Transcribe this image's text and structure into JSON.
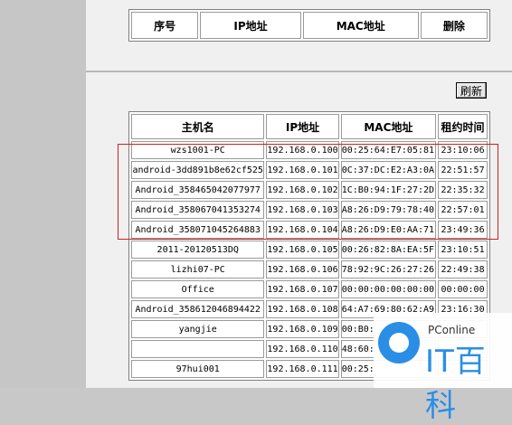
{
  "top_table": {
    "headers": [
      "序号",
      "IP地址",
      "MAC地址",
      "删除"
    ]
  },
  "refresh_label": "刷新",
  "dhcp_table": {
    "headers": [
      "主机名",
      "IP地址",
      "MAC地址",
      "租约时间"
    ],
    "rows": [
      [
        "wzs1001-PC",
        "192.168.0.100",
        "00:25:64:E7:05:81",
        "23:10:06"
      ],
      [
        "android-3dd891b8e62cf525",
        "192.168.0.101",
        "0C:37:DC:E2:A3:0A",
        "22:51:57"
      ],
      [
        "Android_358465042077977",
        "192.168.0.102",
        "1C:B0:94:1F:27:2D",
        "22:35:32"
      ],
      [
        "Android_358067041353274",
        "192.168.0.103",
        "A8:26:D9:79:78:40",
        "22:57:01"
      ],
      [
        "Android_358071045264883",
        "192.168.0.104",
        "A8:26:D9:E0:AA:71",
        "23:49:36"
      ],
      [
        "2011-20120513DQ",
        "192.168.0.105",
        "00:26:82:8A:EA:5F",
        "23:10:51"
      ],
      [
        "lizhi07-PC",
        "192.168.0.106",
        "78:92:9C:26:27:26",
        "22:49:38"
      ],
      [
        "Office",
        "192.168.0.107",
        "00:00:00:00:00:00",
        "00:00:00"
      ],
      [
        "Android_358612046894422",
        "192.168.0.108",
        "64:A7:69:80:62:A9",
        "23:16:30"
      ],
      [
        "yangjie",
        "192.168.0.109",
        "00:B0:",
        ""
      ],
      [
        "",
        "192.168.0.110",
        "48:60:",
        ""
      ],
      [
        "97hui001",
        "192.168.0.111",
        "00:25:",
        ""
      ]
    ]
  },
  "watermark": {
    "site": "PConline",
    "brand": "IT百科"
  },
  "colors": {
    "highlight": "#d02020",
    "brand": "#2a8ee6"
  }
}
